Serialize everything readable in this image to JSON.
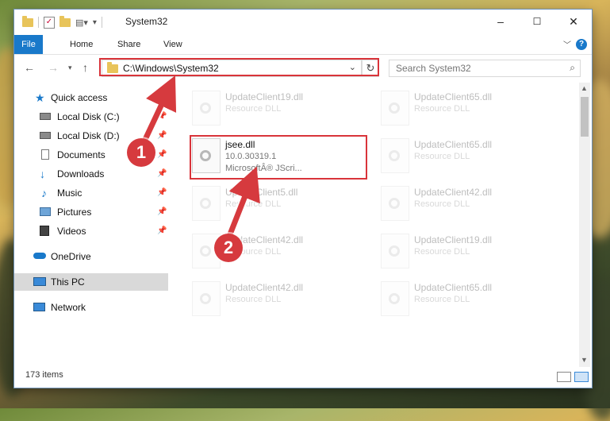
{
  "window": {
    "title": "System32",
    "controls": {
      "minimize": "–",
      "maximize": "☐",
      "close": "✕"
    }
  },
  "ribbon": {
    "tabs": [
      "File",
      "Home",
      "Share",
      "View"
    ],
    "help": "?"
  },
  "address": {
    "path": "C:\\Windows\\System32",
    "search_placeholder": "Search System32"
  },
  "nav": {
    "quick_access": "Quick access",
    "items": [
      {
        "label": "Local Disk (C:)",
        "pinned": true
      },
      {
        "label": "Local Disk (D:)",
        "pinned": true
      },
      {
        "label": "Documents",
        "pinned": true
      },
      {
        "label": "Downloads",
        "pinned": true
      },
      {
        "label": "Music",
        "pinned": true
      },
      {
        "label": "Pictures",
        "pinned": true
      },
      {
        "label": "Videos",
        "pinned": true
      }
    ],
    "onedrive": "OneDrive",
    "this_pc": "This PC",
    "network": "Network"
  },
  "files": {
    "left": [
      {
        "name": "UpdateClient19.dll",
        "desc": "Resource DLL"
      },
      {
        "name": "jsee.dll",
        "version": "10.0.30319.1",
        "company": "MicrosoftÂ® JScri..."
      },
      {
        "name": "UpdateClient5.dll",
        "desc": "Resource DLL"
      },
      {
        "name": "UpdateClient42.dll",
        "desc": "Resource DLL"
      },
      {
        "name": "UpdateClient42.dll",
        "desc": "Resource DLL"
      }
    ],
    "right": [
      {
        "name": "UpdateClient65.dll",
        "desc": "Resource DLL"
      },
      {
        "name": "UpdateClient65.dll",
        "desc": "Resource DLL"
      },
      {
        "name": "UpdateClient42.dll",
        "desc": "Resource DLL"
      },
      {
        "name": "UpdateClient19.dll",
        "desc": "Resource DLL"
      },
      {
        "name": "UpdateClient65.dll",
        "desc": "Resource DLL"
      }
    ]
  },
  "status": {
    "item_count": "173 items"
  },
  "callouts": [
    "1",
    "2"
  ],
  "colors": {
    "highlight": "#d9343a",
    "accent": "#1979ca",
    "callout": "#d63a3e"
  }
}
